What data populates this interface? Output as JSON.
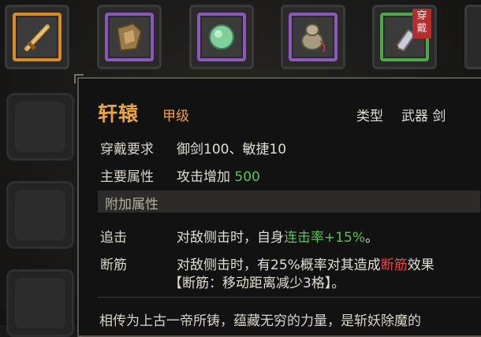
{
  "equipment_slots": [
    {
      "name": "sword-item",
      "rarity_color": "#d88a2b"
    },
    {
      "name": "armor-item",
      "rarity_color": "#8b57b9"
    },
    {
      "name": "jade-item",
      "rarity_color": "#8b57b9"
    },
    {
      "name": "gourd-item",
      "rarity_color": "#8b57b9"
    },
    {
      "name": "cleaver-item",
      "rarity_color": "#4aa74a",
      "badge": "穿戴"
    }
  ],
  "tooltip": {
    "item_name": "轩辕",
    "grade": "甲级",
    "type_label": "类型",
    "type_value": "武器 剑",
    "requirement_label": "穿戴要求",
    "requirement_value": "御剑100、敏捷10",
    "main_attr_label": "主要属性",
    "main_attr_text": "攻击增加",
    "main_attr_value": "500",
    "extra_section_label": "附加属性",
    "extras": [
      {
        "label": "追击",
        "text_prefix": "对敌侧击时，自身",
        "highlight": "连击率+15%",
        "text_suffix": "。"
      },
      {
        "label": "断筋",
        "text_prefix": "对敌侧击时，有25%概率对其造成",
        "highlight": "断筋",
        "text_suffix": "效果",
        "line2": "【断筋：移动距离减少3格】。"
      }
    ],
    "description": "相传为上古一帝所铸，蕴藏无穷的力量，是斩妖除魔的"
  }
}
